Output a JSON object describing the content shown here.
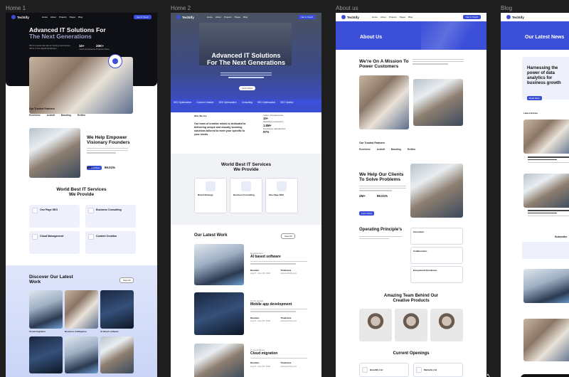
{
  "frames": {
    "home1_label": "Home 1",
    "home2_label": "Home  2",
    "about_label": "About us",
    "blog_label": "Blog"
  },
  "brand": "Techtify",
  "nav": [
    "Home",
    "About",
    "Projects",
    "Pages",
    "Blog"
  ],
  "nav_cta": "Get in Touch",
  "home1": {
    "hero_title_1": "Advanced IT Solutions For",
    "hero_title_2": "The Next Generations",
    "hero_sub": "We're passionate about helping businesses thrive in the digital landscape.",
    "stat1_value": "10+",
    "stat1_label": "Years Experience",
    "stat2_value": "20K+",
    "stat2_label": "Projects Done",
    "partners_title": "Our Trusted Partners",
    "partners": [
      "Excelerise",
      "Acktoft",
      "Branding",
      "Redline"
    ],
    "empower_title_1": "We Help Empower",
    "empower_title_2": "Visionary Founders",
    "empower_stat1": "2M+",
    "empower_stat2": "99.01%",
    "services_title_1": "World Best IT Services",
    "services_title_2": "We Provide",
    "services": [
      {
        "name": "One Page SEO"
      },
      {
        "name": "Business Consulting"
      },
      {
        "name": "Cloud Management"
      },
      {
        "name": "Content Creation"
      }
    ],
    "work_title_1": "Discover Our Latest",
    "work_title_2": "Work",
    "work_items": [
      "Cloud migration",
      "Business Intelligence",
      "AI based software"
    ]
  },
  "home2": {
    "hero_title_1": "Advanced IT Solutions",
    "hero_title_2": "For The Next Generations",
    "strip_items": [
      "SEO Optimization",
      "Content Creation",
      "SEO Optimization",
      "Consulting",
      "SEO Optimization",
      "SEO Optimiz"
    ],
    "who_label": "Who We Are",
    "who_text": "Our team of creative minds is dedicated to delivering unique and visually stunning solutions tailored to meet your specific to your needs.",
    "stat1": "10+",
    "stat2": "1.8M+",
    "stat3": "97%",
    "services_title_1": "World Best IT Services",
    "services_title_2": "We Provide",
    "services": [
      "Brand Strategy",
      "Business Consulting",
      "One Page SEO"
    ],
    "work_title": "Our Latest Work",
    "work_items": [
      {
        "title": "AI based software",
        "label1": "Duration",
        "value1": "Aug 8 - Nov 25, 2024",
        "label2": "Timeframe",
        "value2": "www.techtify.com"
      },
      {
        "title": "Mobile app development",
        "label1": "Duration",
        "value1": "Aug 8 - Nov 25, 2024",
        "label2": "Timeframe",
        "value2": "www.techtify.com"
      },
      {
        "title": "Cloud migration",
        "label1": "Duration",
        "value1": "Aug 8 - Nov 25, 2024",
        "label2": "Timeframe",
        "value2": "www.techtify.com"
      }
    ]
  },
  "about": {
    "banner_title": "About Us",
    "mission_title_1": "We're On A Mission To",
    "mission_title_2": "Power Customers",
    "partners_title": "Our Trusted Partners",
    "partners": [
      "Excelerise",
      "Acktoft",
      "Branding",
      "Redline"
    ],
    "clients_title_1": "We Help Our Clients",
    "clients_title_2": "To Solve Problems",
    "clients_stat1": "2M+",
    "clients_stat2": "99.01%",
    "principles_title": "Operating Principle's",
    "principles": [
      "Innovation",
      "Collaboration",
      "Exceptional Excellence"
    ],
    "team_title_1": "Amazing Team Behind Our",
    "team_title_2": "Creative Products",
    "openings_title": "Current Openings",
    "openings": [
      "Brandify Ltd.",
      "Marketly Ltd."
    ]
  },
  "blog": {
    "banner_title": "Our Latest News",
    "hero_title": "Harnessing the power of data analytics for business growth",
    "latest_label": "Latest articles",
    "subscribe": "Subscribe"
  },
  "colors": {
    "accent": "#3b4fd8",
    "canvas": "#1e1e1e",
    "dark_hero": "#0f1016"
  }
}
